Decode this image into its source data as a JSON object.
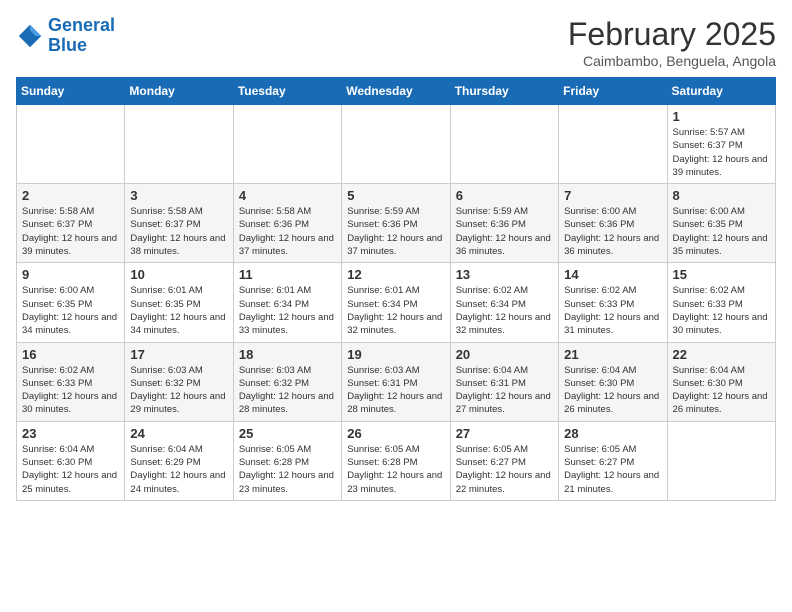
{
  "header": {
    "logo_line1": "General",
    "logo_line2": "Blue",
    "month": "February 2025",
    "location": "Caimbambo, Benguela, Angola"
  },
  "weekdays": [
    "Sunday",
    "Monday",
    "Tuesday",
    "Wednesday",
    "Thursday",
    "Friday",
    "Saturday"
  ],
  "weeks": [
    [
      {
        "day": "",
        "info": ""
      },
      {
        "day": "",
        "info": ""
      },
      {
        "day": "",
        "info": ""
      },
      {
        "day": "",
        "info": ""
      },
      {
        "day": "",
        "info": ""
      },
      {
        "day": "",
        "info": ""
      },
      {
        "day": "1",
        "info": "Sunrise: 5:57 AM\nSunset: 6:37 PM\nDaylight: 12 hours and 39 minutes."
      }
    ],
    [
      {
        "day": "2",
        "info": "Sunrise: 5:58 AM\nSunset: 6:37 PM\nDaylight: 12 hours and 39 minutes."
      },
      {
        "day": "3",
        "info": "Sunrise: 5:58 AM\nSunset: 6:37 PM\nDaylight: 12 hours and 38 minutes."
      },
      {
        "day": "4",
        "info": "Sunrise: 5:58 AM\nSunset: 6:36 PM\nDaylight: 12 hours and 37 minutes."
      },
      {
        "day": "5",
        "info": "Sunrise: 5:59 AM\nSunset: 6:36 PM\nDaylight: 12 hours and 37 minutes."
      },
      {
        "day": "6",
        "info": "Sunrise: 5:59 AM\nSunset: 6:36 PM\nDaylight: 12 hours and 36 minutes."
      },
      {
        "day": "7",
        "info": "Sunrise: 6:00 AM\nSunset: 6:36 PM\nDaylight: 12 hours and 36 minutes."
      },
      {
        "day": "8",
        "info": "Sunrise: 6:00 AM\nSunset: 6:35 PM\nDaylight: 12 hours and 35 minutes."
      }
    ],
    [
      {
        "day": "9",
        "info": "Sunrise: 6:00 AM\nSunset: 6:35 PM\nDaylight: 12 hours and 34 minutes."
      },
      {
        "day": "10",
        "info": "Sunrise: 6:01 AM\nSunset: 6:35 PM\nDaylight: 12 hours and 34 minutes."
      },
      {
        "day": "11",
        "info": "Sunrise: 6:01 AM\nSunset: 6:34 PM\nDaylight: 12 hours and 33 minutes."
      },
      {
        "day": "12",
        "info": "Sunrise: 6:01 AM\nSunset: 6:34 PM\nDaylight: 12 hours and 32 minutes."
      },
      {
        "day": "13",
        "info": "Sunrise: 6:02 AM\nSunset: 6:34 PM\nDaylight: 12 hours and 32 minutes."
      },
      {
        "day": "14",
        "info": "Sunrise: 6:02 AM\nSunset: 6:33 PM\nDaylight: 12 hours and 31 minutes."
      },
      {
        "day": "15",
        "info": "Sunrise: 6:02 AM\nSunset: 6:33 PM\nDaylight: 12 hours and 30 minutes."
      }
    ],
    [
      {
        "day": "16",
        "info": "Sunrise: 6:02 AM\nSunset: 6:33 PM\nDaylight: 12 hours and 30 minutes."
      },
      {
        "day": "17",
        "info": "Sunrise: 6:03 AM\nSunset: 6:32 PM\nDaylight: 12 hours and 29 minutes."
      },
      {
        "day": "18",
        "info": "Sunrise: 6:03 AM\nSunset: 6:32 PM\nDaylight: 12 hours and 28 minutes."
      },
      {
        "day": "19",
        "info": "Sunrise: 6:03 AM\nSunset: 6:31 PM\nDaylight: 12 hours and 28 minutes."
      },
      {
        "day": "20",
        "info": "Sunrise: 6:04 AM\nSunset: 6:31 PM\nDaylight: 12 hours and 27 minutes."
      },
      {
        "day": "21",
        "info": "Sunrise: 6:04 AM\nSunset: 6:30 PM\nDaylight: 12 hours and 26 minutes."
      },
      {
        "day": "22",
        "info": "Sunrise: 6:04 AM\nSunset: 6:30 PM\nDaylight: 12 hours and 26 minutes."
      }
    ],
    [
      {
        "day": "23",
        "info": "Sunrise: 6:04 AM\nSunset: 6:30 PM\nDaylight: 12 hours and 25 minutes."
      },
      {
        "day": "24",
        "info": "Sunrise: 6:04 AM\nSunset: 6:29 PM\nDaylight: 12 hours and 24 minutes."
      },
      {
        "day": "25",
        "info": "Sunrise: 6:05 AM\nSunset: 6:28 PM\nDaylight: 12 hours and 23 minutes."
      },
      {
        "day": "26",
        "info": "Sunrise: 6:05 AM\nSunset: 6:28 PM\nDaylight: 12 hours and 23 minutes."
      },
      {
        "day": "27",
        "info": "Sunrise: 6:05 AM\nSunset: 6:27 PM\nDaylight: 12 hours and 22 minutes."
      },
      {
        "day": "28",
        "info": "Sunrise: 6:05 AM\nSunset: 6:27 PM\nDaylight: 12 hours and 21 minutes."
      },
      {
        "day": "",
        "info": ""
      }
    ]
  ]
}
